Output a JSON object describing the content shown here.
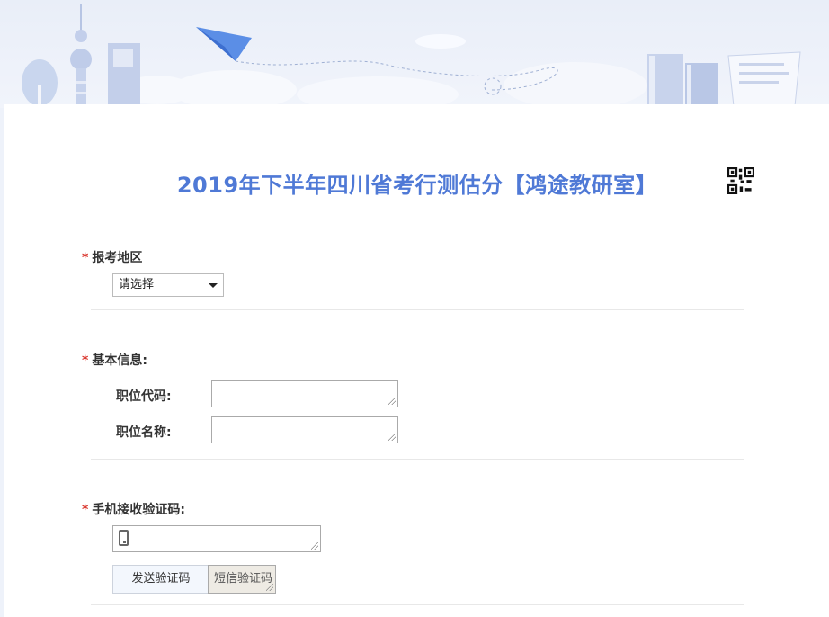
{
  "form": {
    "title": "2019年下半年四川省考行测估分【鸿途教研室】",
    "required_mark": "*",
    "region": {
      "label": "报考地区",
      "select_value": "请选择"
    },
    "basic_info": {
      "label": "基本信息:",
      "position_code_label": "职位代码:",
      "position_name_label": "职位名称:"
    },
    "phone_code": {
      "label": "手机接收验证码:",
      "send_button": "发送验证码",
      "sms_placeholder": "短信验证码"
    }
  },
  "colors": {
    "title": "#4f79d6",
    "required": "#d9342b",
    "background": "#eef2fa"
  },
  "icons": {
    "qr": "qr-code-icon",
    "phone": "mobile-phone-icon",
    "dropdown": "chevron-down-icon"
  }
}
